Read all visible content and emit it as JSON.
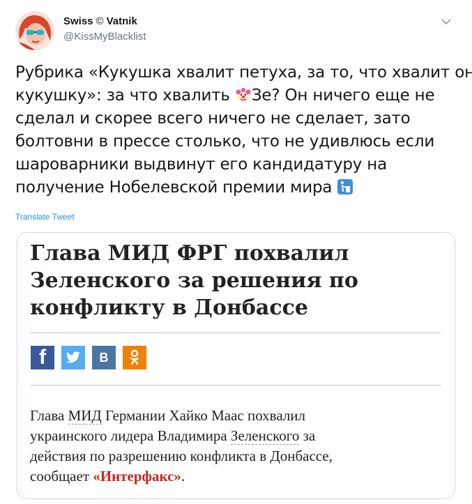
{
  "author": {
    "display_name": "Swiss",
    "display_name_suffix": "Vatnik",
    "handle": "@KissMyBlacklist"
  },
  "tweet": {
    "lines": [
      "Рубрика «Кукушка хвалит петуха, за то, что хвалит он",
      "кукушку»: за что хвалить",
      "Зе? Он ничего еще не",
      "сделал и скорее всего ничего не сделает, зато",
      "болтовни в прессе столько, что не удивлюсь если",
      "шароварники выдвинут его кандидатуру на",
      "получение Нобелевской премии мира"
    ],
    "emoji_1": "clown-face",
    "emoji_2": "put-litter-in-its-place",
    "translate_label": "Translate Tweet"
  },
  "card": {
    "headline_lines": [
      "Глава МИД ФРГ похвалил",
      "Зеленского за решения по",
      "конфликту в Донбассе"
    ],
    "share_buttons": [
      {
        "name": "facebook",
        "glyph": "f",
        "color": "#3b5998"
      },
      {
        "name": "twitter",
        "glyph": "",
        "color": "#55acee"
      },
      {
        "name": "vkontakte",
        "glyph": "В",
        "color": "#4c75a3"
      },
      {
        "name": "odnoklassniki",
        "glyph": "",
        "color": "#ee8208"
      }
    ],
    "lead": {
      "l1_a": "Глава ",
      "l1_link": "МИД",
      "l1_b": " Германии Хайко Маас похвалил",
      "l2_a": "украинского лидера Владимира ",
      "l2_link": "Зеленского",
      "l2_b": " за",
      "l3": "действия по разрешению конфликта в Донбассе,",
      "l4_a": "сообщает ",
      "l4_source": "«Интерфакс»",
      "l4_b": "."
    }
  },
  "colors": {
    "link": "#1b95e0",
    "source_link": "#c4271d",
    "secondary_text": "#657786"
  }
}
